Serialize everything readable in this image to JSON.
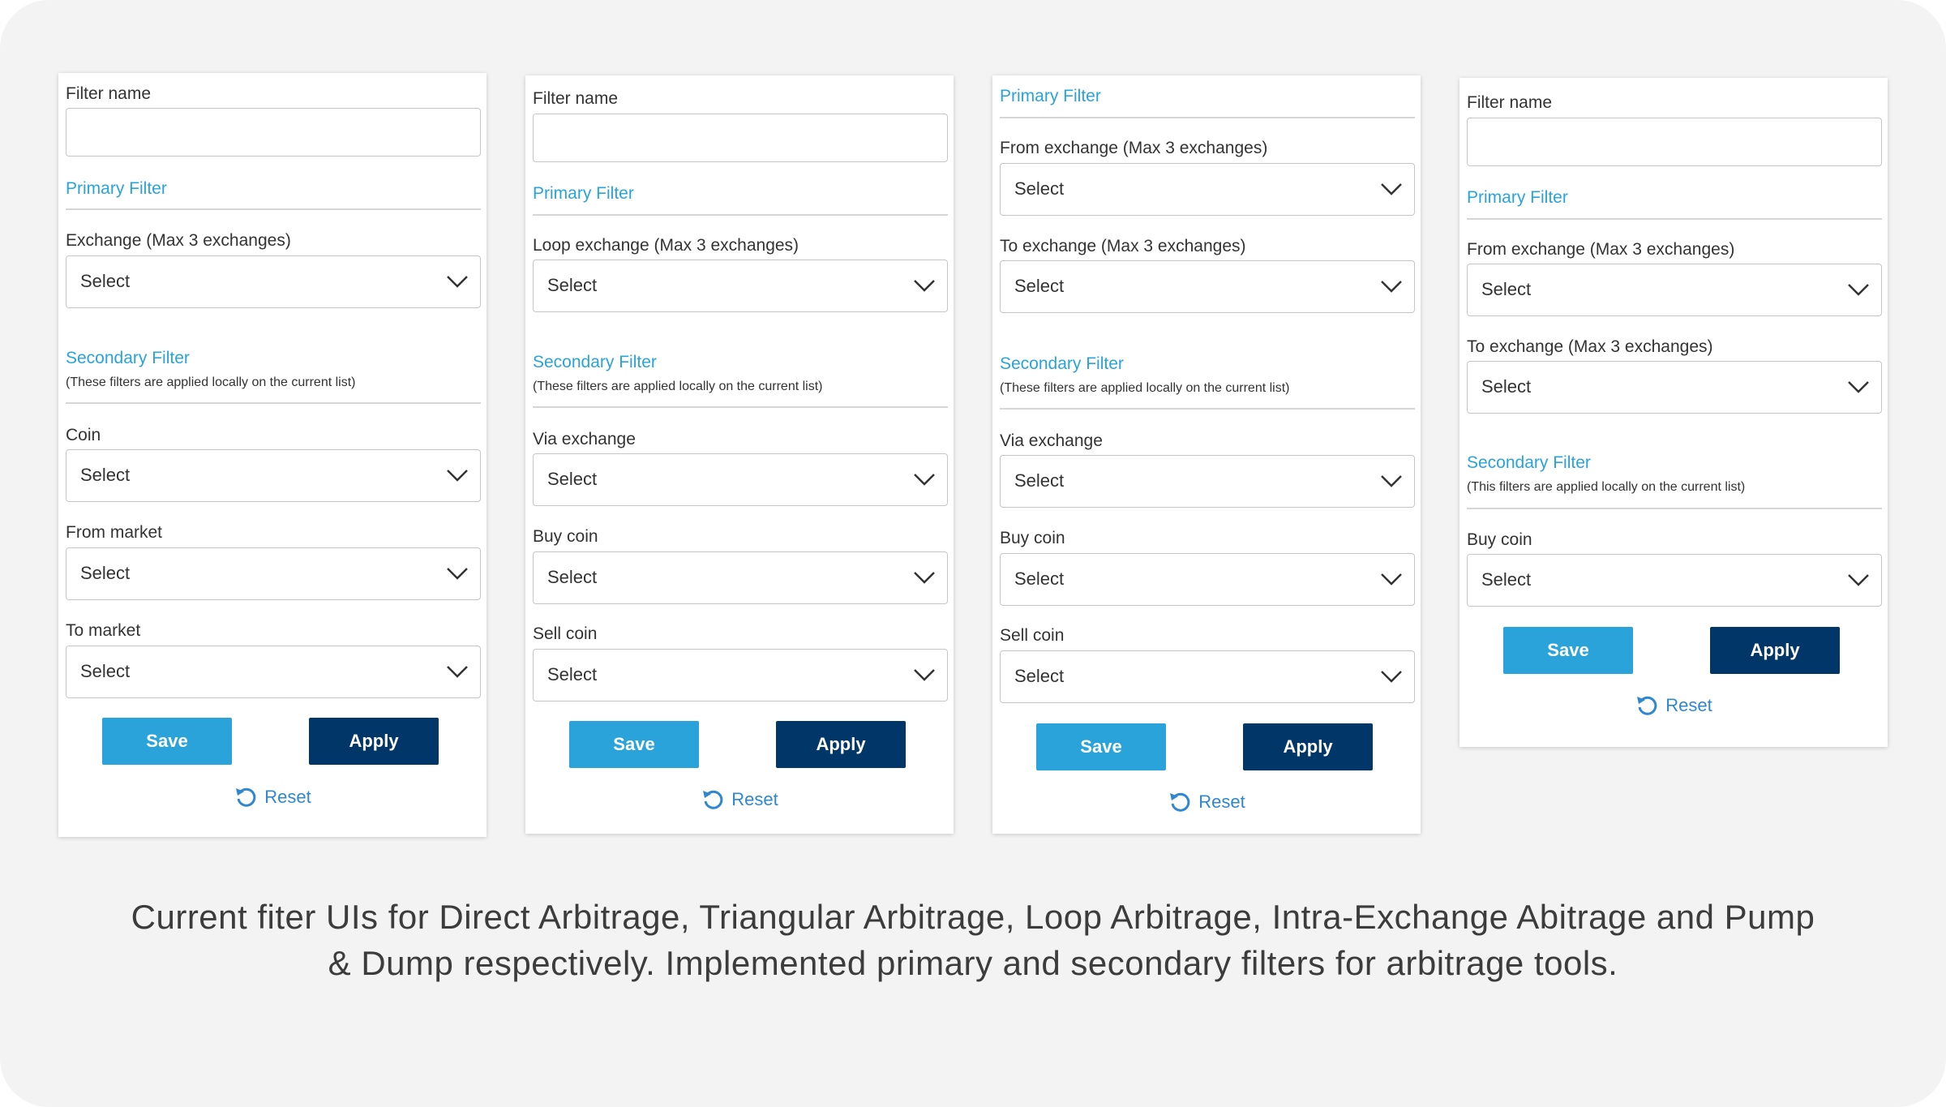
{
  "panels": [
    {
      "filter_name_label": "Filter name",
      "primary_title": "Primary Filter",
      "primary_fields": [
        {
          "label": "Exchange (Max 3 exchanges)",
          "value": "Select"
        }
      ],
      "secondary_title": "Secondary Filter",
      "secondary_note": "(These filters are applied locally on the current list)",
      "secondary_fields": [
        {
          "label": "Coin",
          "value": "Select"
        },
        {
          "label": "From market",
          "value": "Select"
        },
        {
          "label": "To market",
          "value": "Select"
        }
      ],
      "save_label": "Save",
      "apply_label": "Apply",
      "reset_label": "Reset"
    },
    {
      "filter_name_label": "Filter name",
      "primary_title": "Primary Filter",
      "primary_fields": [
        {
          "label": "Loop exchange (Max 3 exchanges)",
          "value": "Select"
        }
      ],
      "secondary_title": "Secondary Filter",
      "secondary_note": "(These filters are applied locally on the current list)",
      "secondary_fields": [
        {
          "label": "Via exchange",
          "value": "Select"
        },
        {
          "label": "Buy coin",
          "value": "Select"
        },
        {
          "label": "Sell coin",
          "value": "Select"
        }
      ],
      "save_label": "Save",
      "apply_label": "Apply",
      "reset_label": "Reset"
    },
    {
      "primary_title": "Primary Filter",
      "primary_fields": [
        {
          "label": "From exchange (Max 3 exchanges)",
          "value": "Select"
        },
        {
          "label": "To exchange (Max 3 exchanges)",
          "value": "Select"
        }
      ],
      "secondary_title": "Secondary Filter",
      "secondary_note": "(These filters are applied locally on the current list)",
      "secondary_fields": [
        {
          "label": "Via exchange",
          "value": "Select"
        },
        {
          "label": "Buy coin",
          "value": "Select"
        },
        {
          "label": "Sell coin",
          "value": "Select"
        }
      ],
      "save_label": "Save",
      "apply_label": "Apply",
      "reset_label": "Reset"
    },
    {
      "filter_name_label": "Filter name",
      "primary_title": "Primary Filter",
      "primary_fields": [
        {
          "label": "From exchange (Max 3 exchanges)",
          "value": "Select"
        },
        {
          "label": "To exchange (Max 3 exchanges)",
          "value": "Select"
        }
      ],
      "secondary_title": "Secondary Filter",
      "secondary_note": "(This filters are applied locally on the current list)",
      "secondary_fields": [
        {
          "label": "Buy coin",
          "value": "Select"
        }
      ],
      "save_label": "Save",
      "apply_label": "Apply",
      "reset_label": "Reset"
    }
  ],
  "caption": "Current fiter UIs for Direct Arbitrage, Triangular Arbitrage, Loop Arbitrage, Intra-Exchange Abitrage and Pump & Dump respectively. Implemented primary and secondary filters for arbitrage tools.",
  "colors": {
    "accent": "#2aa3db",
    "primary_button": "#003668",
    "link": "#2f87cf",
    "background": "#f3f3f3"
  }
}
